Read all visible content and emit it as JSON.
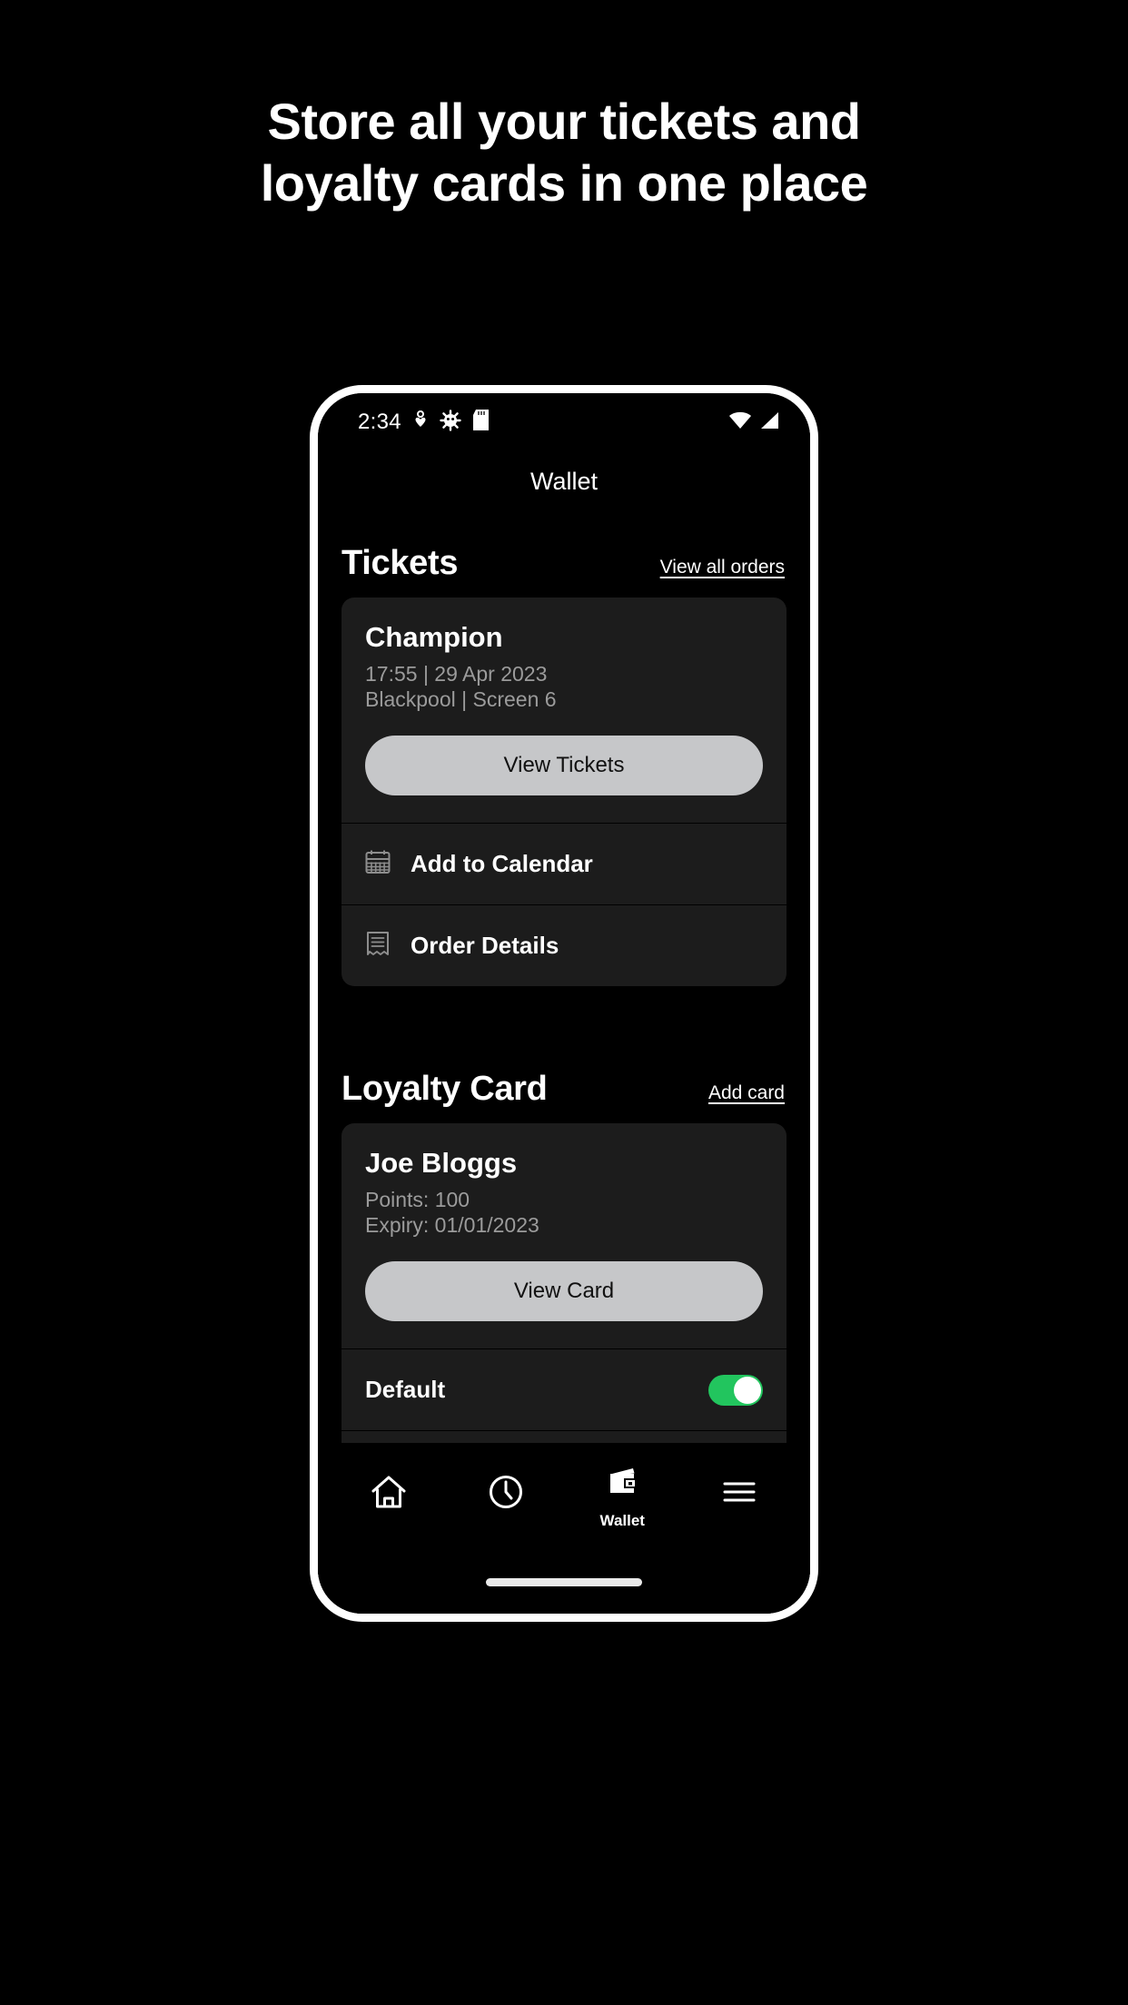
{
  "hero": {
    "headline_line1": "Store all your tickets and",
    "headline_line2": "loyalty cards in one place"
  },
  "colors": {
    "page_background": "#000000",
    "card_background": "#1c1c1c",
    "primary_button": "#c6c7c9",
    "toggle_on": "#22c55e",
    "muted_text": "#9b9b9b",
    "frame": "#ffffff"
  },
  "phone": {
    "status_bar": {
      "time": "2:34",
      "icons_left": [
        "health-heart-icon",
        "android-debug-bug-icon",
        "sd-card-icon"
      ],
      "icons_right": [
        "wifi-icon",
        "cellular-signal-icon"
      ]
    },
    "app_bar": {
      "title": "Wallet"
    },
    "tickets_section": {
      "title": "Tickets",
      "action_label": "View all orders",
      "card": {
        "title": "Champion",
        "line1": "17:55 | 29 Apr 2023",
        "line2": "Blackpool | Screen 6",
        "primary_button": "View Tickets",
        "rows": [
          {
            "label": "Add to Calendar",
            "icon": "calendar-icon"
          },
          {
            "label": "Order Details",
            "icon": "receipt-icon"
          }
        ]
      }
    },
    "loyalty_section": {
      "title": "Loyalty Card",
      "action_label": "Add card",
      "card": {
        "title": "Joe Bloggs",
        "line1": "Points: 100",
        "line2": "Expiry: 01/01/2023",
        "primary_button": "View Card",
        "toggle_row": {
          "label": "Default",
          "state": "on"
        }
      }
    },
    "bottom_nav": [
      {
        "label": "",
        "icon": "home-icon",
        "active": false
      },
      {
        "label": "",
        "icon": "history-clock-icon",
        "active": false
      },
      {
        "label": "Wallet",
        "icon": "wallet-icon",
        "active": true
      },
      {
        "label": "",
        "icon": "menu-hamburger-icon",
        "active": false
      }
    ]
  }
}
